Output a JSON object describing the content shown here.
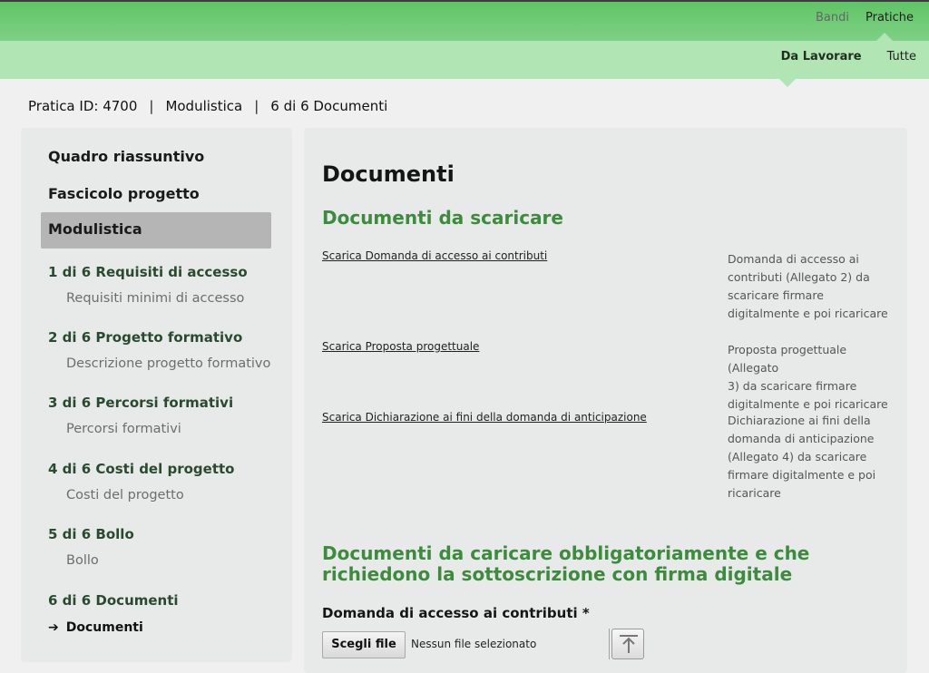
{
  "topnav": {
    "items": [
      {
        "label": "Bandi"
      },
      {
        "label": "Pratiche"
      }
    ]
  },
  "subnav": {
    "items": [
      {
        "label": "Da Lavorare"
      },
      {
        "label": "Tutte"
      }
    ]
  },
  "breadcrumb": {
    "pratica": "Pratica ID: 4700",
    "section": "Modulistica",
    "progress": "6 di 6 Documenti",
    "separator": "|"
  },
  "sidebar": {
    "quadro": "Quadro riassuntivo",
    "fascicolo": "Fascicolo progetto",
    "modulistica": "Modulistica",
    "steps": [
      {
        "label": "1 di 6 Requisiti di accesso",
        "sub": "Requisiti minimi di accesso"
      },
      {
        "label": "2 di 6 Progetto formativo",
        "sub": "Descrizione progetto formativo"
      },
      {
        "label": "3 di 6 Percorsi formativi",
        "sub": "Percorsi formativi"
      },
      {
        "label": "4 di 6 Costi del progetto",
        "sub": "Costi del progetto"
      },
      {
        "label": "5 di 6 Bollo",
        "sub": "Bollo"
      },
      {
        "label": "6 di 6 Documenti",
        "sub": "Documenti"
      }
    ],
    "current_arrow": "➔"
  },
  "main": {
    "title": "Documenti",
    "download_heading": "Documenti da scaricare",
    "downloads": [
      {
        "link": "Scarica Domanda di accesso ai contributi",
        "desc_lines": [
          "Domanda di accesso ai",
          "contributi (Allegato 2) da",
          "scaricare firmare",
          "digitalmente e poi ricaricare"
        ]
      },
      {
        "link": "Scarica Proposta progettuale",
        "desc_lines": [
          "Proposta progettuale (Allegato",
          "3) da scaricare firmare",
          "digitalmente e poi ricaricare"
        ]
      },
      {
        "link": "Scarica Dichiarazione ai fini della domanda di anticipazione",
        "desc_lines": [
          "Dichiarazione ai fini della",
          "domanda di anticipazione",
          "(Allegato 4) da scaricare",
          "firmare digitalmente e poi",
          "ricaricare"
        ]
      }
    ],
    "upload_heading_line1": "Documenti da caricare obbligatoriamente e che",
    "upload_heading_line2": "richiedono la sottoscrizione con firma digitale",
    "field_label": "Domanda di accesso ai contributi *",
    "file_button": "Scegli file",
    "file_none": "Nessun file selezionato",
    "upload_icon": "upload-arrow-icon"
  }
}
